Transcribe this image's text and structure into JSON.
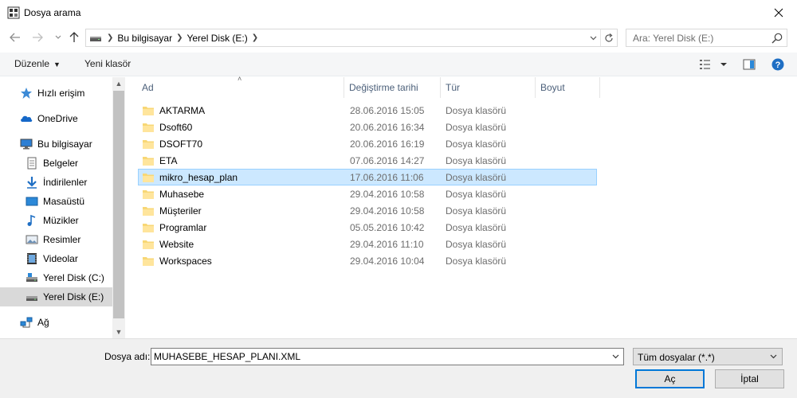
{
  "window": {
    "title": "Dosya arama"
  },
  "address": {
    "crumbs": [
      "Bu bilgisayar",
      "Yerel Disk (E:)"
    ]
  },
  "search": {
    "placeholder": "Ara: Yerel Disk (E:)"
  },
  "toolbar": {
    "organize_label": "Düzenle",
    "new_folder_label": "Yeni klasör"
  },
  "sidebar": {
    "items": [
      {
        "label": "Hızlı erişim",
        "icon": "star-icon"
      },
      {
        "label": "OneDrive",
        "icon": "cloud-icon"
      },
      {
        "label": "Bu bilgisayar",
        "icon": "computer-icon"
      },
      {
        "label": "Belgeler",
        "icon": "documents-icon"
      },
      {
        "label": "İndirilenler",
        "icon": "download-icon"
      },
      {
        "label": "Masaüstü",
        "icon": "desktop-icon"
      },
      {
        "label": "Müzikler",
        "icon": "music-icon"
      },
      {
        "label": "Resimler",
        "icon": "pictures-icon"
      },
      {
        "label": "Videolar",
        "icon": "video-icon"
      },
      {
        "label": "Yerel Disk (C:)",
        "icon": "drive-icon"
      },
      {
        "label": "Yerel Disk (E:)",
        "icon": "drive-icon",
        "selected": true
      },
      {
        "label": "Ağ",
        "icon": "network-icon"
      }
    ]
  },
  "filelist": {
    "columns": [
      "Ad",
      "Değiştirme tarihi",
      "Tür",
      "Boyut"
    ],
    "rows": [
      {
        "name": "AKTARMA",
        "date": "28.06.2016 15:05",
        "type": "Dosya klasörü"
      },
      {
        "name": "Dsoft60",
        "date": "20.06.2016 16:34",
        "type": "Dosya klasörü"
      },
      {
        "name": "DSOFT70",
        "date": "20.06.2016 16:19",
        "type": "Dosya klasörü"
      },
      {
        "name": "ETA",
        "date": "07.06.2016 14:27",
        "type": "Dosya klasörü"
      },
      {
        "name": "mikro_hesap_plan",
        "date": "17.06.2016 11:06",
        "type": "Dosya klasörü",
        "selected": true
      },
      {
        "name": "Muhasebe",
        "date": "29.04.2016 10:58",
        "type": "Dosya klasörü"
      },
      {
        "name": "Müşteriler",
        "date": "29.04.2016 10:58",
        "type": "Dosya klasörü"
      },
      {
        "name": "Programlar",
        "date": "05.05.2016 10:42",
        "type": "Dosya klasörü"
      },
      {
        "name": "Website",
        "date": "29.04.2016 11:10",
        "type": "Dosya klasörü"
      },
      {
        "name": "Workspaces",
        "date": "29.04.2016 10:04",
        "type": "Dosya klasörü"
      }
    ]
  },
  "bottom": {
    "filename_label": "Dosya adı:",
    "filename_value": "MUHASEBE_HESAP_PLANI.XML",
    "filetype_value": "Tüm dosyalar (*.*)",
    "open_label": "Aç",
    "cancel_label": "İptal"
  },
  "colors": {
    "accent": "#0078d7",
    "selection": "#cce8ff",
    "selection_border": "#99d1ff",
    "folder": "#f8d775"
  }
}
